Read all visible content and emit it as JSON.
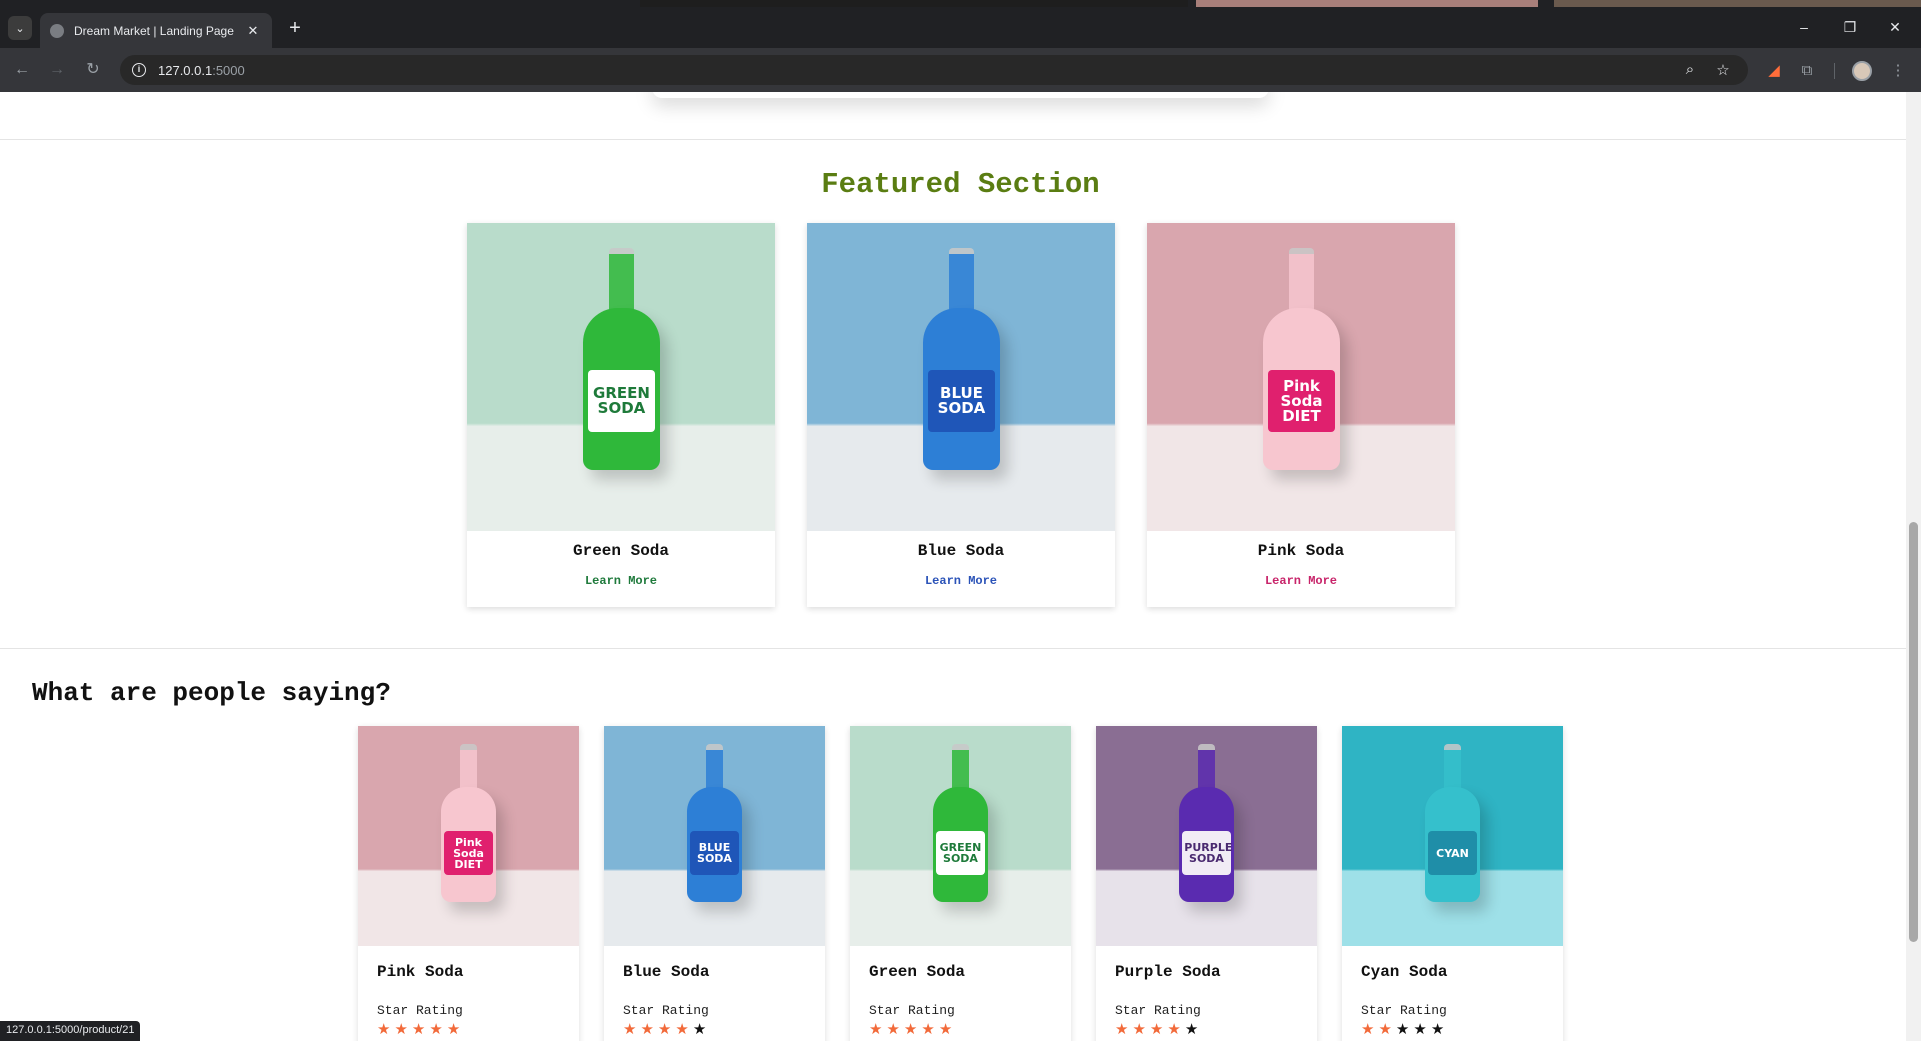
{
  "browser": {
    "tab_title": "Dream Market | Landing Page",
    "tab_close": "✕",
    "new_tab": "+",
    "url_host": "127.0.0.1",
    "url_port": ":5000",
    "status_url": "127.0.0.1:5000/product/21"
  },
  "featured": {
    "title": "Featured Section",
    "products": [
      {
        "name": "Green Soda",
        "link": "Learn More",
        "link_color": "#1f7a3c",
        "bg_top": "#b9dccb",
        "bg_bottom": "#e7eeea",
        "liquid": "#2fb83a",
        "label_text": "GREEN SODA",
        "label_bg": "#ffffff",
        "label_color": "#1e7a3a"
      },
      {
        "name": "Blue Soda",
        "link": "Learn More",
        "link_color": "#2b53b8",
        "bg_top": "#7fb5d6",
        "bg_bottom": "#e6eaed",
        "liquid": "#2d7fd6",
        "label_text": "BLUE SODA",
        "label_bg": "#1f56b8",
        "label_color": "#ffffff"
      },
      {
        "name": "Pink Soda",
        "link": "Learn More",
        "link_color": "#c8246a",
        "bg_top": "#d9a6ae",
        "bg_bottom": "#f1e6e7",
        "liquid": "#f7c6cf",
        "label_text": "Pink Soda DIET",
        "label_bg": "#e0206e",
        "label_color": "#ffffff"
      }
    ]
  },
  "reviews": {
    "title": "What are people saying?",
    "rating_label": "Star Rating",
    "items": [
      {
        "name": "Pink Soda",
        "rating": 5,
        "bg_top": "#d9a6ae",
        "bg_bottom": "#f1e6e7",
        "liquid": "#f7c6cf",
        "label_text": "Pink Soda DIET",
        "label_bg": "#e0206e",
        "label_color": "#ffffff"
      },
      {
        "name": "Blue Soda",
        "rating": 4,
        "bg_top": "#7fb5d6",
        "bg_bottom": "#e6eaed",
        "liquid": "#2d7fd6",
        "label_text": "BLUE SODA",
        "label_bg": "#1f56b8",
        "label_color": "#ffffff"
      },
      {
        "name": "Green Soda",
        "rating": 5,
        "bg_top": "#b9dccb",
        "bg_bottom": "#e7eeea",
        "liquid": "#2fb83a",
        "label_text": "GREEN SODA",
        "label_bg": "#ffffff",
        "label_color": "#1e7a3a"
      },
      {
        "name": "Purple Soda",
        "rating": 4,
        "bg_top": "#8a6e93",
        "bg_bottom": "#e7e2ea",
        "liquid": "#5a2bb0",
        "label_text": "PURPLE SODA",
        "label_bg": "#f1ecf5",
        "label_color": "#4a2a70"
      },
      {
        "name": "Cyan Soda",
        "rating": 2,
        "bg_top": "#2fb4c4",
        "bg_bottom": "#9ee0e8",
        "liquid": "#35c0cc",
        "label_text": "CYAN",
        "label_bg": "#1f8ea8",
        "label_color": "#ffffff"
      }
    ]
  }
}
